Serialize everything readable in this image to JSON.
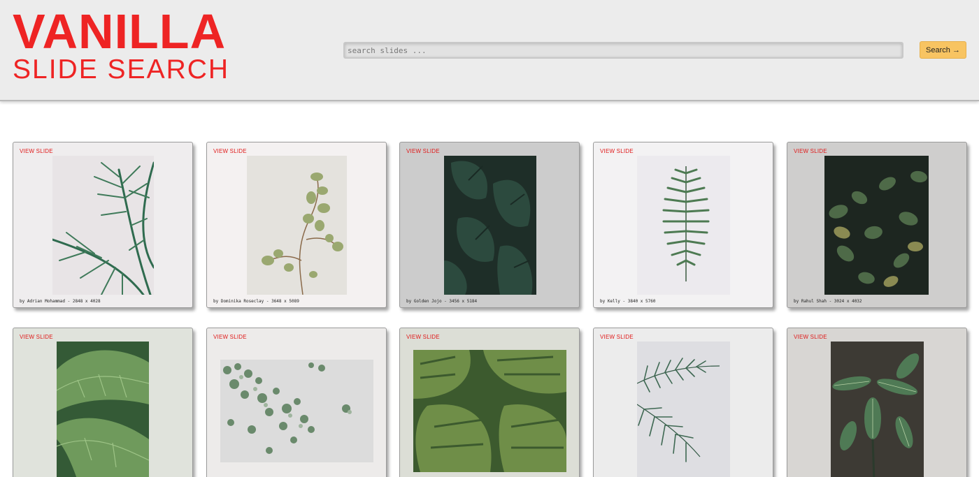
{
  "header": {
    "logo_line1": "VANILLA",
    "logo_line2": "SLIDE SEARCH",
    "search_placeholder": "search slides ...",
    "search_button": "Search →"
  },
  "cards": [
    {
      "link": "VIEW SLIDE",
      "caption": "by Adrian Mohammad - 2848 x 4028",
      "subject": "palm fronds",
      "bg": "#efedee"
    },
    {
      "link": "VIEW SLIDE",
      "caption": "by Dominika Roseclay - 3648 x 5089",
      "subject": "eucalyptus branch",
      "bg": "#f4f1f1"
    },
    {
      "link": "VIEW SLIDE",
      "caption": "by Golden Jojo - 3456 x 5184",
      "subject": "monstera leaves",
      "bg": "#cccccc"
    },
    {
      "link": "VIEW SLIDE",
      "caption": "by Kelly - 3840 x 5760",
      "subject": "fern leaf",
      "bg": "#f3f2f3"
    },
    {
      "link": "VIEW SLIDE",
      "caption": "by Rahul Shah - 3024 x 4032",
      "subject": "dense shrub leaves",
      "bg": "#cfcecd"
    },
    {
      "link": "VIEW SLIDE",
      "caption": "",
      "subject": "large green leaves",
      "bg": "#e0e3dc"
    },
    {
      "link": "VIEW SLIDE",
      "caption": "",
      "subject": "succulents on sand",
      "bg": "#edebea"
    },
    {
      "link": "VIEW SLIDE",
      "caption": "",
      "subject": "monstera pattern",
      "bg": "#dcded6"
    },
    {
      "link": "VIEW SLIDE",
      "caption": "",
      "subject": "sago palm",
      "bg": "#ececec"
    },
    {
      "link": "VIEW SLIDE",
      "caption": "",
      "subject": "striped leaf plant",
      "bg": "#d8d6d3"
    }
  ]
}
